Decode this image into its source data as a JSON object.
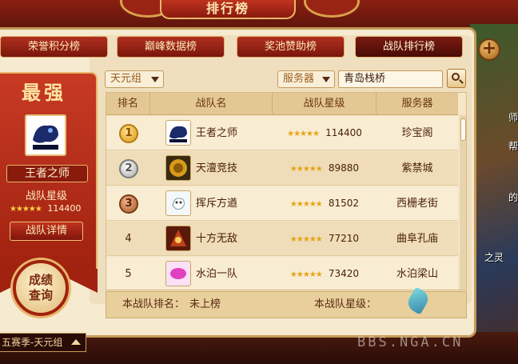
{
  "title": "排行榜",
  "tabs": [
    {
      "label": "荣誉积分榜",
      "active": false
    },
    {
      "label": "巅峰数据榜",
      "active": false
    },
    {
      "label": "奖池赞助榜",
      "active": false
    },
    {
      "label": "战队排行榜",
      "active": true
    }
  ],
  "close_icon": "close-icon",
  "top_team": {
    "header": "最强",
    "name": "王者之师",
    "rating_label": "战队星级",
    "stars": "★★★★★",
    "rating": "114400",
    "detail_button": "战队详情"
  },
  "score_button": "成绩查询",
  "filters": {
    "group": "天元组",
    "server_label": "服务器",
    "search_value": "青岛栈桥"
  },
  "table": {
    "columns": [
      "排名",
      "战队名",
      "战队星级",
      "服务器"
    ],
    "rows": [
      {
        "rank": "1",
        "medal": "gold",
        "team": "王者之师",
        "stars": "★★★★★",
        "rating": "114400",
        "server": "珍宝阁",
        "logo_color": "#1a2a6a"
      },
      {
        "rank": "2",
        "medal": "silver",
        "team": "天澶竞技",
        "stars": "★★★★★",
        "rating": "89880",
        "server": "紫禁城",
        "logo_color": "#b8860b"
      },
      {
        "rank": "3",
        "medal": "bronze",
        "team": "挥斥方遒",
        "stars": "★★★★★",
        "rating": "81502",
        "server": "西栅老街",
        "logo_color": "#e8f0f0"
      },
      {
        "rank": "4",
        "medal": "",
        "team": "十方无敌",
        "stars": "★★★★★",
        "rating": "77210",
        "server": "曲阜孔庙",
        "logo_color": "#a0301a"
      },
      {
        "rank": "5",
        "medal": "",
        "team": "水泊一队",
        "stars": "★★★★★",
        "rating": "73420",
        "server": "水泊梁山",
        "logo_color": "#e040c0"
      }
    ]
  },
  "footer": {
    "my_rank_label": "本战队排名：",
    "my_rank_value": "未上榜",
    "my_rating_label": "本战队星级："
  },
  "season": "五赛季-天元组",
  "watermark": "BBS.NGA.CN",
  "side_texts": [
    "师",
    "帮",
    "的",
    "之灵"
  ]
}
